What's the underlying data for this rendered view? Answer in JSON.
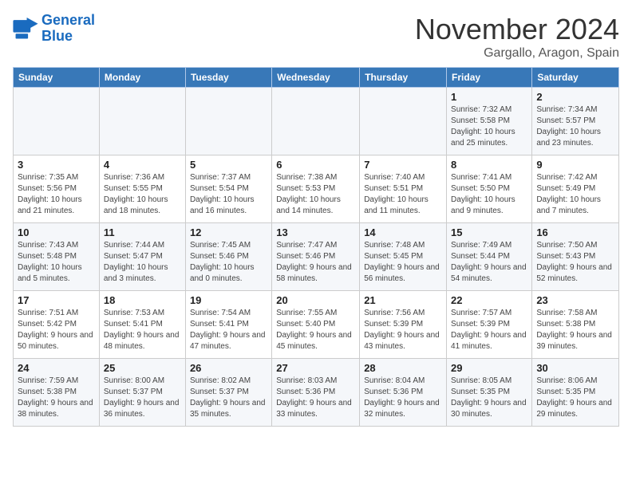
{
  "logo": {
    "line1": "General",
    "line2": "Blue"
  },
  "header": {
    "month": "November 2024",
    "location": "Gargallo, Aragon, Spain"
  },
  "weekdays": [
    "Sunday",
    "Monday",
    "Tuesday",
    "Wednesday",
    "Thursday",
    "Friday",
    "Saturday"
  ],
  "weeks": [
    [
      {
        "day": "",
        "info": ""
      },
      {
        "day": "",
        "info": ""
      },
      {
        "day": "",
        "info": ""
      },
      {
        "day": "",
        "info": ""
      },
      {
        "day": "",
        "info": ""
      },
      {
        "day": "1",
        "info": "Sunrise: 7:32 AM\nSunset: 5:58 PM\nDaylight: 10 hours and 25 minutes."
      },
      {
        "day": "2",
        "info": "Sunrise: 7:34 AM\nSunset: 5:57 PM\nDaylight: 10 hours and 23 minutes."
      }
    ],
    [
      {
        "day": "3",
        "info": "Sunrise: 7:35 AM\nSunset: 5:56 PM\nDaylight: 10 hours and 21 minutes."
      },
      {
        "day": "4",
        "info": "Sunrise: 7:36 AM\nSunset: 5:55 PM\nDaylight: 10 hours and 18 minutes."
      },
      {
        "day": "5",
        "info": "Sunrise: 7:37 AM\nSunset: 5:54 PM\nDaylight: 10 hours and 16 minutes."
      },
      {
        "day": "6",
        "info": "Sunrise: 7:38 AM\nSunset: 5:53 PM\nDaylight: 10 hours and 14 minutes."
      },
      {
        "day": "7",
        "info": "Sunrise: 7:40 AM\nSunset: 5:51 PM\nDaylight: 10 hours and 11 minutes."
      },
      {
        "day": "8",
        "info": "Sunrise: 7:41 AM\nSunset: 5:50 PM\nDaylight: 10 hours and 9 minutes."
      },
      {
        "day": "9",
        "info": "Sunrise: 7:42 AM\nSunset: 5:49 PM\nDaylight: 10 hours and 7 minutes."
      }
    ],
    [
      {
        "day": "10",
        "info": "Sunrise: 7:43 AM\nSunset: 5:48 PM\nDaylight: 10 hours and 5 minutes."
      },
      {
        "day": "11",
        "info": "Sunrise: 7:44 AM\nSunset: 5:47 PM\nDaylight: 10 hours and 3 minutes."
      },
      {
        "day": "12",
        "info": "Sunrise: 7:45 AM\nSunset: 5:46 PM\nDaylight: 10 hours and 0 minutes."
      },
      {
        "day": "13",
        "info": "Sunrise: 7:47 AM\nSunset: 5:46 PM\nDaylight: 9 hours and 58 minutes."
      },
      {
        "day": "14",
        "info": "Sunrise: 7:48 AM\nSunset: 5:45 PM\nDaylight: 9 hours and 56 minutes."
      },
      {
        "day": "15",
        "info": "Sunrise: 7:49 AM\nSunset: 5:44 PM\nDaylight: 9 hours and 54 minutes."
      },
      {
        "day": "16",
        "info": "Sunrise: 7:50 AM\nSunset: 5:43 PM\nDaylight: 9 hours and 52 minutes."
      }
    ],
    [
      {
        "day": "17",
        "info": "Sunrise: 7:51 AM\nSunset: 5:42 PM\nDaylight: 9 hours and 50 minutes."
      },
      {
        "day": "18",
        "info": "Sunrise: 7:53 AM\nSunset: 5:41 PM\nDaylight: 9 hours and 48 minutes."
      },
      {
        "day": "19",
        "info": "Sunrise: 7:54 AM\nSunset: 5:41 PM\nDaylight: 9 hours and 47 minutes."
      },
      {
        "day": "20",
        "info": "Sunrise: 7:55 AM\nSunset: 5:40 PM\nDaylight: 9 hours and 45 minutes."
      },
      {
        "day": "21",
        "info": "Sunrise: 7:56 AM\nSunset: 5:39 PM\nDaylight: 9 hours and 43 minutes."
      },
      {
        "day": "22",
        "info": "Sunrise: 7:57 AM\nSunset: 5:39 PM\nDaylight: 9 hours and 41 minutes."
      },
      {
        "day": "23",
        "info": "Sunrise: 7:58 AM\nSunset: 5:38 PM\nDaylight: 9 hours and 39 minutes."
      }
    ],
    [
      {
        "day": "24",
        "info": "Sunrise: 7:59 AM\nSunset: 5:38 PM\nDaylight: 9 hours and 38 minutes."
      },
      {
        "day": "25",
        "info": "Sunrise: 8:00 AM\nSunset: 5:37 PM\nDaylight: 9 hours and 36 minutes."
      },
      {
        "day": "26",
        "info": "Sunrise: 8:02 AM\nSunset: 5:37 PM\nDaylight: 9 hours and 35 minutes."
      },
      {
        "day": "27",
        "info": "Sunrise: 8:03 AM\nSunset: 5:36 PM\nDaylight: 9 hours and 33 minutes."
      },
      {
        "day": "28",
        "info": "Sunrise: 8:04 AM\nSunset: 5:36 PM\nDaylight: 9 hours and 32 minutes."
      },
      {
        "day": "29",
        "info": "Sunrise: 8:05 AM\nSunset: 5:35 PM\nDaylight: 9 hours and 30 minutes."
      },
      {
        "day": "30",
        "info": "Sunrise: 8:06 AM\nSunset: 5:35 PM\nDaylight: 9 hours and 29 minutes."
      }
    ]
  ]
}
